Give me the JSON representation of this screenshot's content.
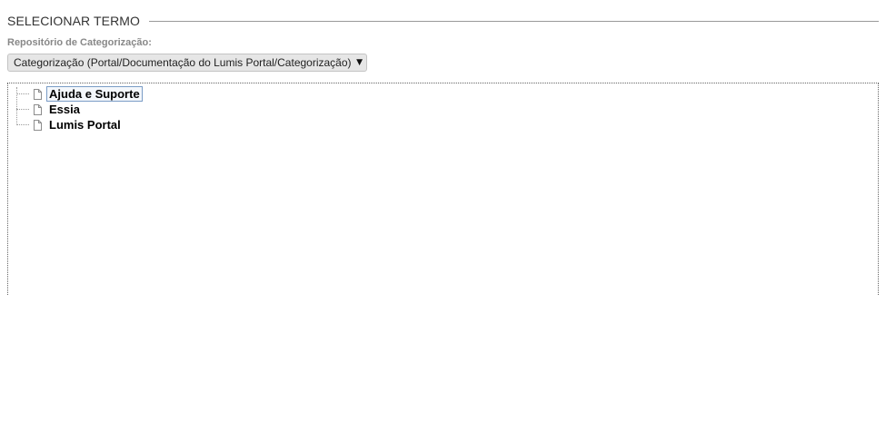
{
  "section": {
    "title": "SELECIONAR TERMO"
  },
  "repository": {
    "label": "Repositório de Categorização:",
    "selected": "Categorização (Portal/Documentação do Lumis Portal/Categorização)",
    "arrow_icon": "dropdown-arrow-icon"
  },
  "tree": {
    "node_icon": "document-icon",
    "nodes": [
      {
        "label": "Ajuda e Suporte",
        "selected": true
      },
      {
        "label": "Essia",
        "selected": false
      },
      {
        "label": "Lumis Portal",
        "selected": false
      }
    ]
  },
  "colors": {
    "select_bg": "#e6e6e6",
    "selection_border": "#7a9cc6",
    "label_gray": "#888888"
  }
}
